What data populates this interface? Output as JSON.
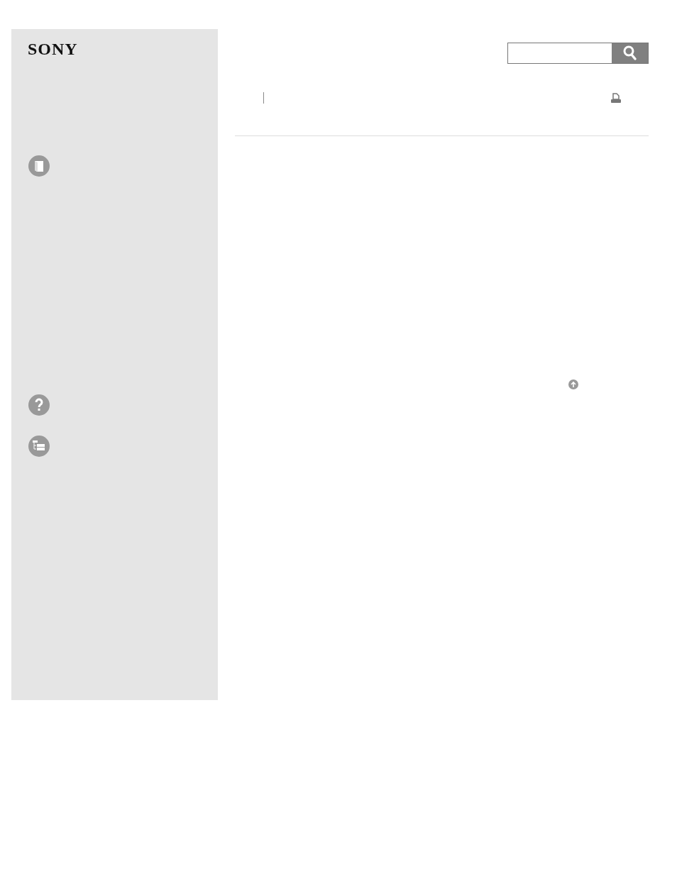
{
  "logo": {
    "text": "SONY"
  }
}
